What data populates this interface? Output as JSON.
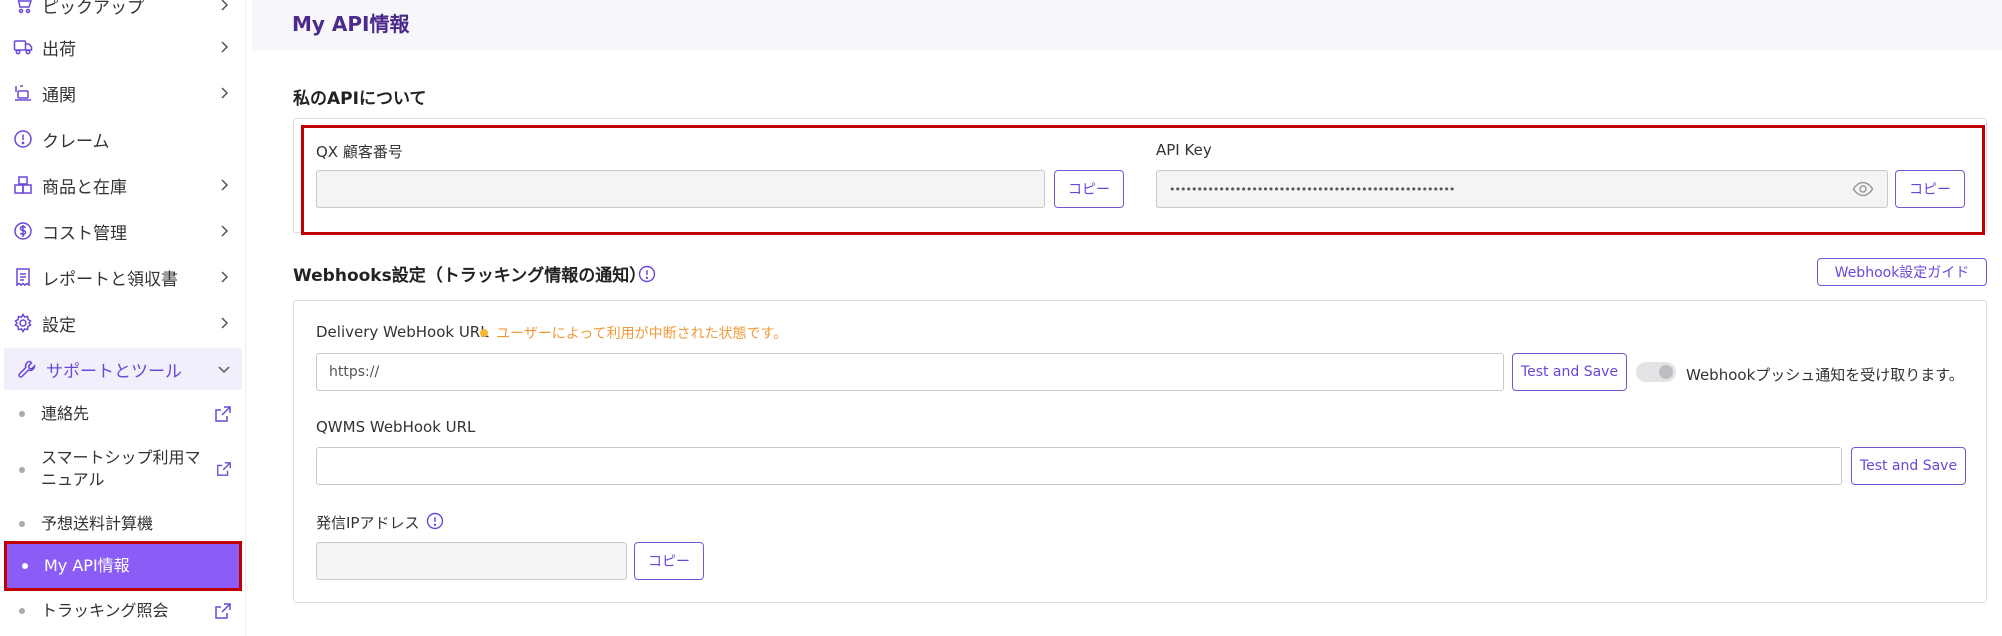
{
  "sidebar": {
    "items": [
      {
        "label": "ピックアップ",
        "icon": "cart-icon"
      },
      {
        "label": "出荷",
        "icon": "truck-icon"
      },
      {
        "label": "通関",
        "icon": "customs-icon"
      },
      {
        "label": "クレーム",
        "icon": "alert-circle-icon"
      },
      {
        "label": "商品と在庫",
        "icon": "boxes-icon"
      },
      {
        "label": "コスト管理",
        "icon": "dollar-circle-icon"
      },
      {
        "label": "レポートと領収書",
        "icon": "receipt-icon"
      },
      {
        "label": "設定",
        "icon": "gear-icon"
      },
      {
        "label": "サポートとツール",
        "icon": "wrench-icon"
      }
    ],
    "sub_items": [
      {
        "label": "連絡先"
      },
      {
        "label": "スマートシップ利用マ",
        "label2": "ニュアル"
      },
      {
        "label": "予想送料計算機"
      },
      {
        "label": "My API情報"
      },
      {
        "label": "トラッキング照会"
      }
    ]
  },
  "page": {
    "title": "My API情報",
    "about_title": "私のAPIについて",
    "customer_no_label": "QX 顧客番号",
    "customer_no_value": "",
    "copy_label": "コピー",
    "api_key_label": "API Key",
    "api_key_value": "••••••••••••••••••••••••••••••••••••••••••••••••••••",
    "webhooks_title": "Webhooks設定（トラッキング情報の通知）",
    "webhook_guide_label": "Webhook設定ガイド",
    "delivery_label": "Delivery WebHook URL",
    "delivery_warning": "ユーザーによって利用が中断された状態です。",
    "delivery_value": "https://",
    "test_save_label": "Test and Save",
    "push_toggle_label": "Webhookプッシュ通知を受け取ります。",
    "qwms_label": "QWMS WebHook URL",
    "qwms_value": "",
    "ip_label": "発信IPアドレス",
    "ip_value": ""
  },
  "colors": {
    "accent": "#6a47d8",
    "active_bg": "#8b5cf6",
    "highlight": "#c00000",
    "warning": "#f2993a"
  }
}
